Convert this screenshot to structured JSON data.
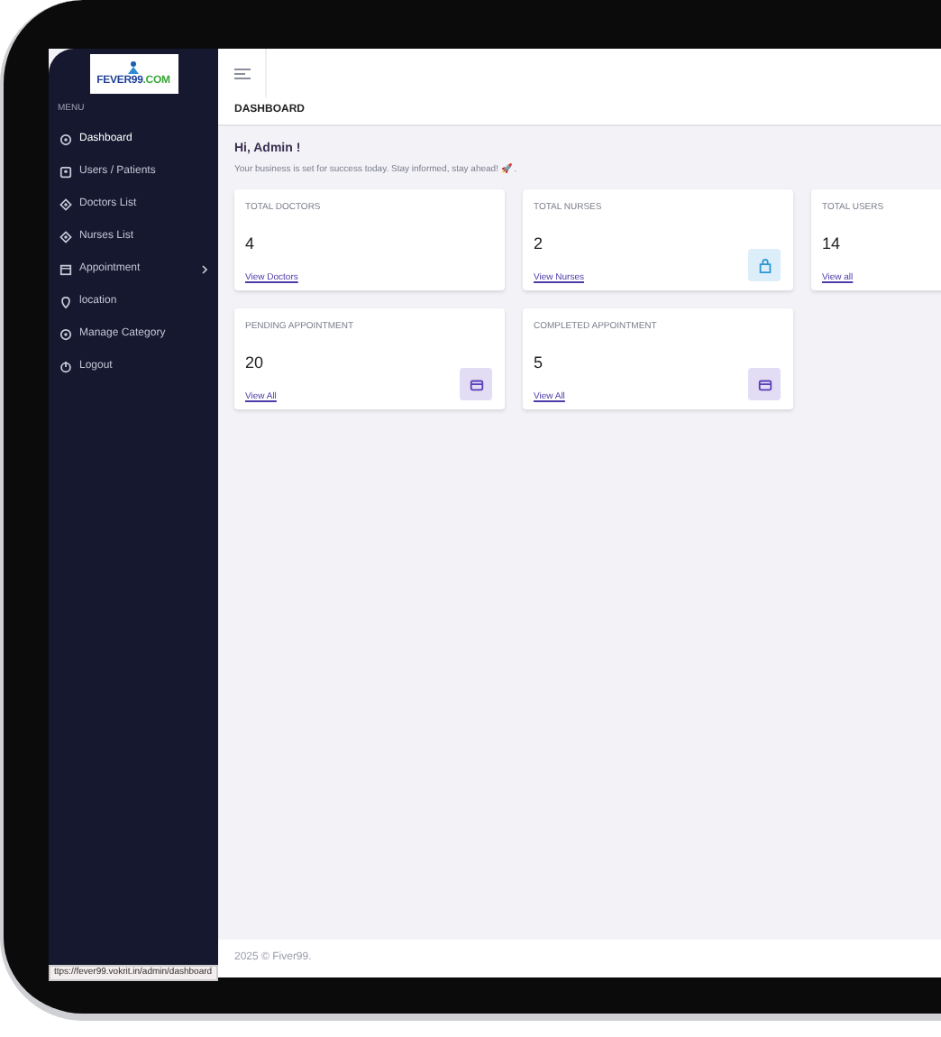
{
  "logo": {
    "name": "FEVER99",
    "suffix": ".COM"
  },
  "sidebar": {
    "heading": "MENU",
    "items": [
      {
        "label": "Dashboard",
        "kind": "gauge",
        "selected": true,
        "submenu": false
      },
      {
        "label": "Users / Patients",
        "kind": "card",
        "selected": false,
        "submenu": false
      },
      {
        "label": "Doctors List",
        "kind": "badge",
        "selected": false,
        "submenu": false
      },
      {
        "label": "Nurses List",
        "kind": "badge",
        "selected": false,
        "submenu": false
      },
      {
        "label": "Appointment",
        "kind": "calendar",
        "selected": false,
        "submenu": true
      },
      {
        "label": "location",
        "kind": "pin",
        "selected": false,
        "submenu": false
      },
      {
        "label": "Manage Category",
        "kind": "gauge",
        "selected": false,
        "submenu": false
      },
      {
        "label": "Logout",
        "kind": "power",
        "selected": false,
        "submenu": false
      }
    ]
  },
  "page_title": "DASHBOARD",
  "greeting": {
    "title": "Hi, Admin !",
    "subtitle": "Your business is set for success today. Stay informed, stay ahead! 🚀 ."
  },
  "cards": [
    {
      "title": "TOTAL DOCTORS",
      "value": "4",
      "link": "View Doctors",
      "kind": "plain"
    },
    {
      "title": "TOTAL NURSES",
      "value": "2",
      "link": "View Nurses",
      "kind": "bag"
    },
    {
      "title": "TOTAL USERS",
      "value": "14",
      "link": "View all",
      "kind": "plain"
    },
    {
      "title": "PENDING APPOINTMENT",
      "value": "20",
      "link": "View All",
      "kind": "wallet"
    },
    {
      "title": "COMPLETED APPOINTMENT",
      "value": "5",
      "link": "View All",
      "kind": "wallet"
    }
  ],
  "footer": "2025 © Fiver99.",
  "status_url": "ttps://fever99.vokrit.in/admin/dashboard"
}
